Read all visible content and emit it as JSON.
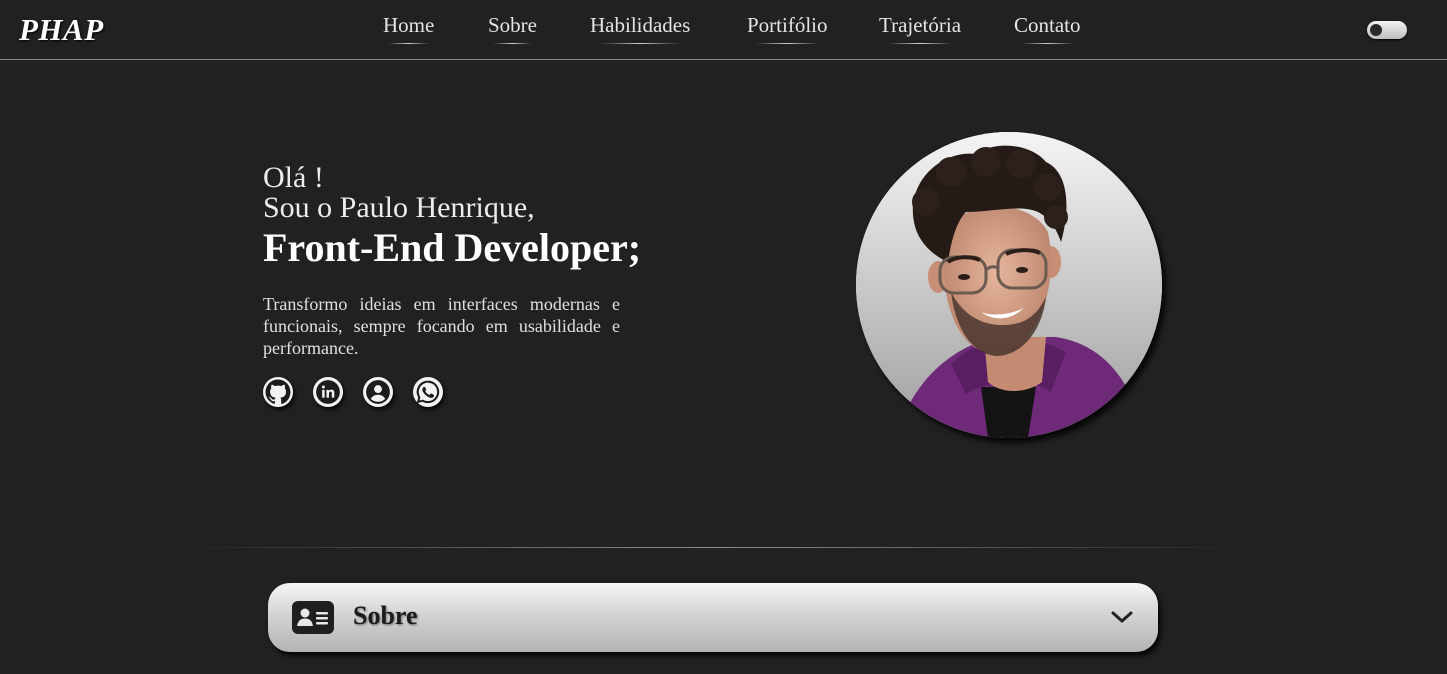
{
  "header": {
    "logo": "PHAP",
    "nav": [
      {
        "label": "Home"
      },
      {
        "label": "Sobre"
      },
      {
        "label": "Habilidades"
      },
      {
        "label": "Portifólio"
      },
      {
        "label": "Trajetória"
      },
      {
        "label": "Contato"
      }
    ],
    "theme_toggle": {
      "icon": "toggle-switch"
    }
  },
  "hero": {
    "greeting": "Olá !",
    "intro": "Sou o Paulo Henrique,",
    "role": "Front-End Developer;",
    "description": "Transformo ideias em interfaces modernas e funcionais, sempre focando em usabilidade e performance.",
    "socials": [
      {
        "icon": "github-icon"
      },
      {
        "icon": "linkedin-icon"
      },
      {
        "icon": "user-icon"
      },
      {
        "icon": "whatsapp-icon"
      }
    ]
  },
  "accordion": {
    "title": "Sobre",
    "icon": "id-card-icon",
    "chevron": "chevron-down-icon"
  },
  "colors": {
    "background": "#212121",
    "text": "#ececec",
    "accordion_gradient_top": "#f7f7f7",
    "accordion_gradient_bottom": "#b3b3b3",
    "hoodie": "#6e2a78"
  }
}
